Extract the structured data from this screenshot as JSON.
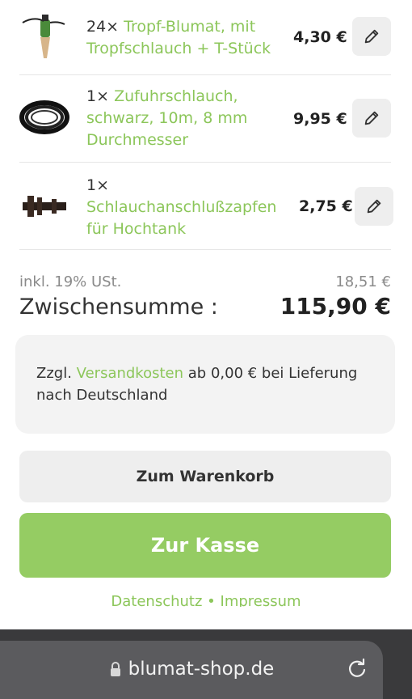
{
  "items": [
    {
      "qty": "24×",
      "name": "Tropf-Blumat, mit Tropfschlauch + T-Stück",
      "name_lines": [
        "Tropf-Blumat, mit",
        "Tropfschlauch + T-Stück"
      ],
      "price": "4,30 €",
      "image": "drip-blumat-image"
    },
    {
      "qty": "1×",
      "name": "Zufuhrschlauch, schwarz, 10m, 8 mm Durchmesser",
      "name_lines": [
        "Zufuhrschlauch,",
        "schwarz, 10m, 8 mm",
        "Durchmesser"
      ],
      "price": "9,95 €",
      "image": "hose-coil-image"
    },
    {
      "qty": "1×",
      "name": "Schlauchanschlußzapfen für Hochtank",
      "name_lines": [
        "Schlauchanschlußzapfen",
        "für Hochtank"
      ],
      "price": "2,75 €",
      "image": "hose-connector-image"
    }
  ],
  "edit_icon": "pencil-icon",
  "summary": {
    "vat_label": "inkl. 19% USt.",
    "vat_amount": "18,51 €",
    "subtotal_label": "Zwischensumme :",
    "subtotal_amount": "115,90 €"
  },
  "shipping": {
    "prefix": "Zzgl.",
    "link": "Versandkosten",
    "suffix": "ab 0,00 € bei Lieferung nach Deutschland"
  },
  "buttons": {
    "cart": "Zum Warenkorb",
    "checkout": "Zur Kasse"
  },
  "footer": {
    "datenschutz": "Datenschutz",
    "sep": "•",
    "impressum": "Impressum"
  },
  "browser": {
    "url": "blumat-shop.de",
    "lock_icon": "lock-icon",
    "reload_icon": "reload-icon"
  },
  "colors": {
    "accent": "#8cc65a",
    "checkout_bg": "#95cc63",
    "button_bg": "#eeeeee",
    "browser_bar": "#3a3a3c"
  }
}
